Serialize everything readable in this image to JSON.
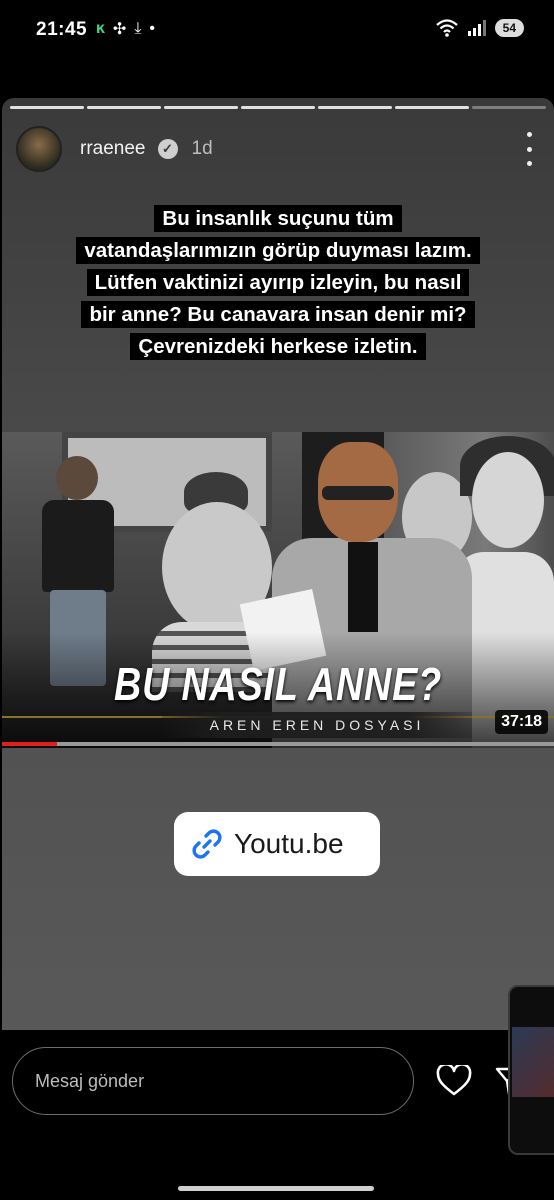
{
  "status_bar": {
    "time": "21:45",
    "battery": "54",
    "wifi_label": "5"
  },
  "story": {
    "username": "rraenee",
    "time_ago": "1d",
    "progress_segments": 7,
    "caption_lines": [
      "Bu insanlık suçunu tüm",
      "vatandaşlarımızın görüp duyması lazım.",
      "Lütfen vaktinizi ayırıp izleyin, bu nasıl",
      "bir anne? Bu canavara insan denir mi?",
      "Çevrenizdeki herkese izletin."
    ],
    "video": {
      "title": "BU NASIL ANNE?",
      "subtitle": "AREN EREN DOSYASI",
      "duration": "37:18",
      "watched_fraction": 0.1
    },
    "link_sticker": {
      "label": "Youtu.be",
      "icon": "link-icon"
    }
  },
  "bottom_bar": {
    "message_placeholder": "Mesaj gönder"
  },
  "colors": {
    "accent_red": "#e01e1e",
    "link_blue": "#1d74f5"
  }
}
